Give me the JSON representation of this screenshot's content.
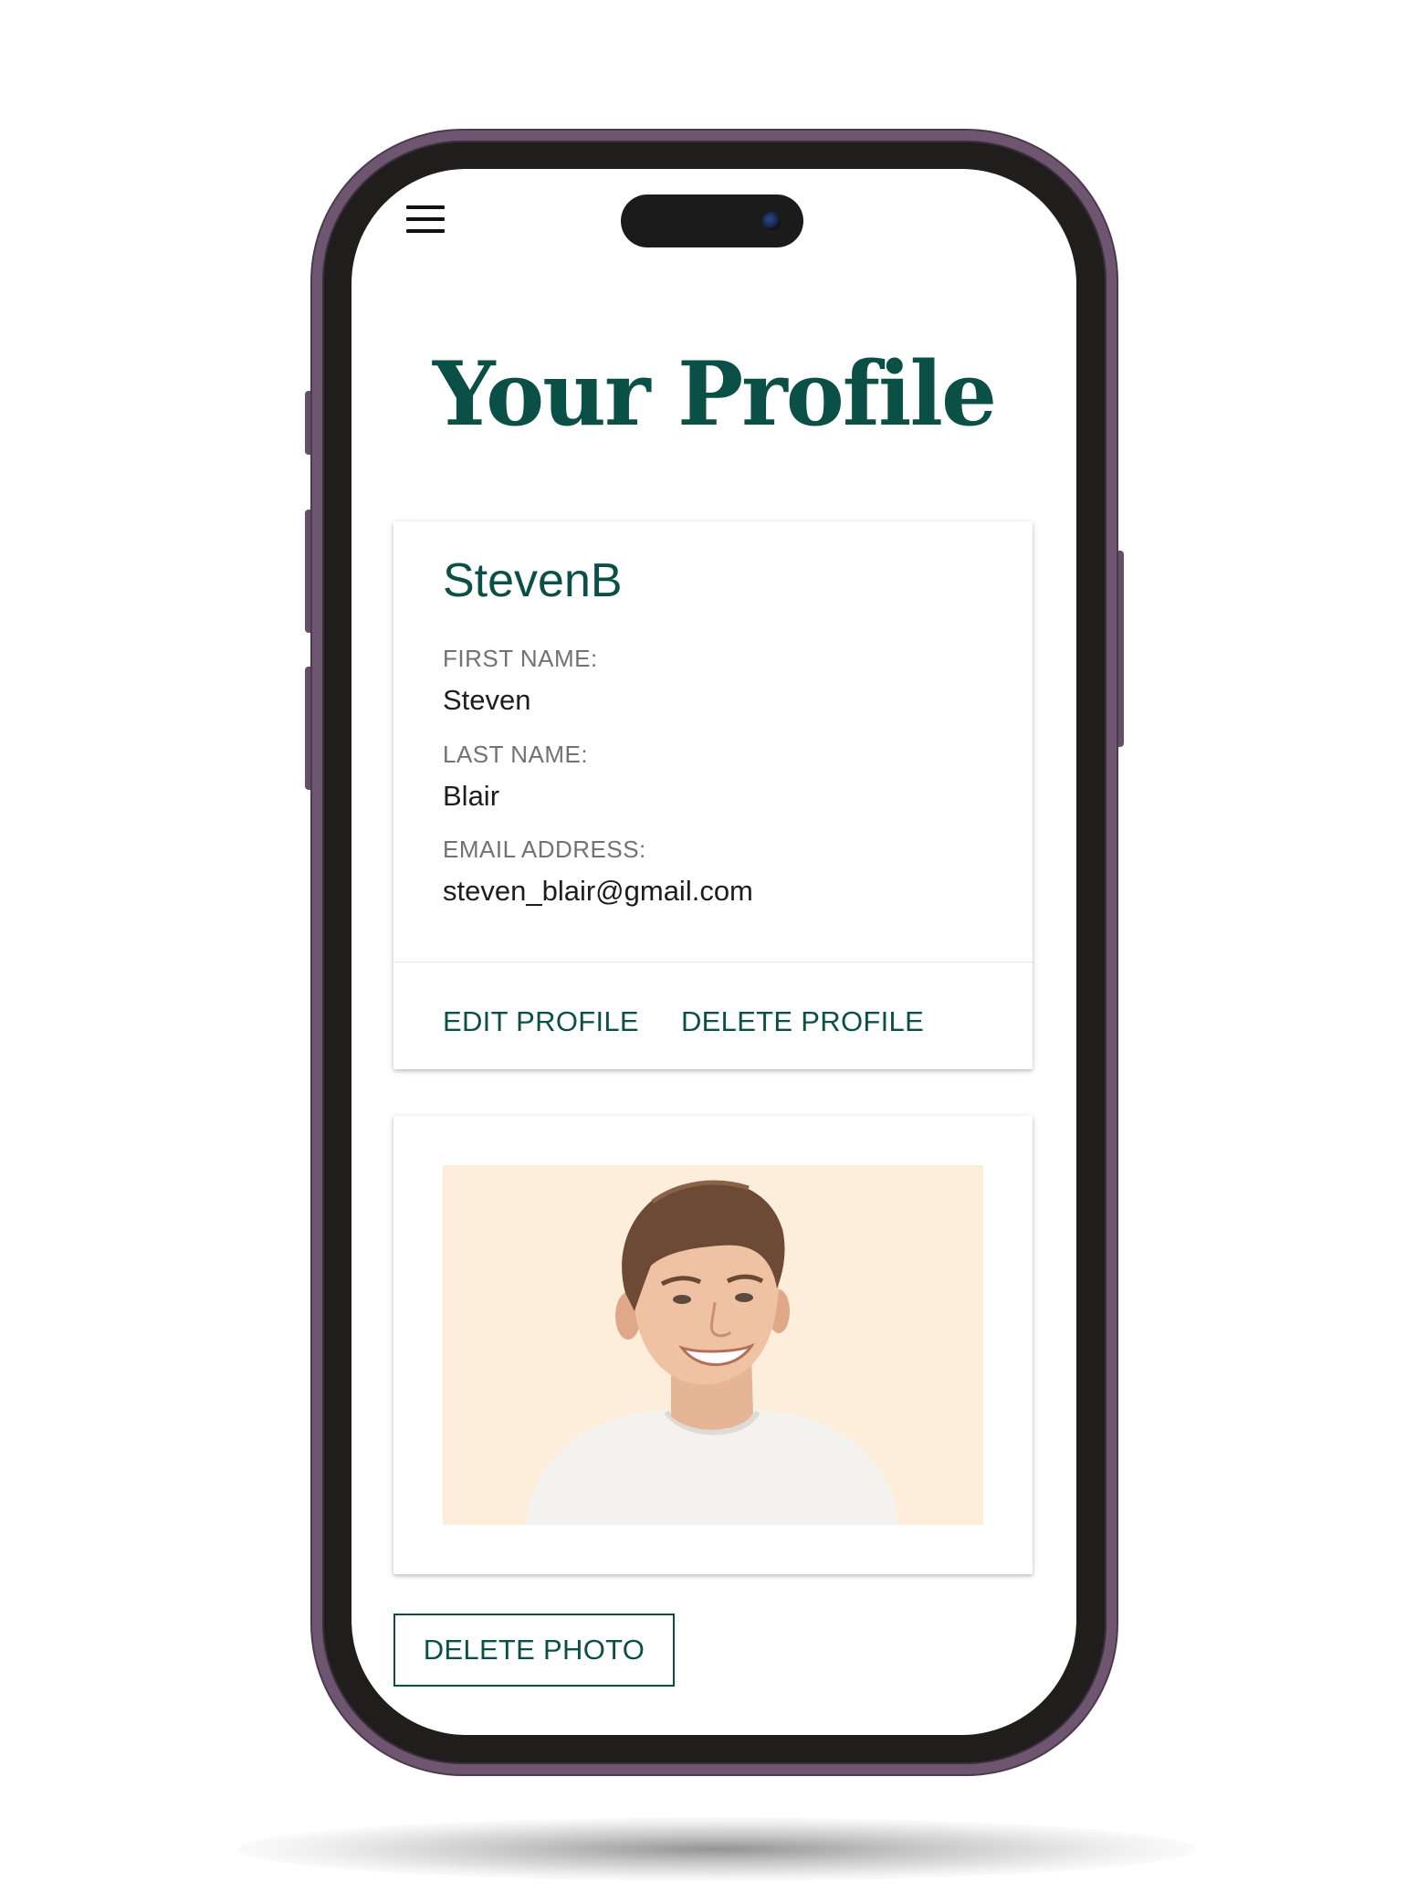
{
  "header": {
    "menu_icon": "hamburger-menu-icon"
  },
  "page": {
    "title": "Your Profile"
  },
  "profile": {
    "username": "StevenB",
    "fields": [
      {
        "label": "FIRST NAME:",
        "value": "Steven"
      },
      {
        "label": "LAST NAME:",
        "value": "Blair"
      },
      {
        "label": "EMAIL ADDRESS:",
        "value": "steven_blair@gmail.com"
      }
    ],
    "actions": {
      "edit_label": "EDIT PROFILE",
      "delete_label": "DELETE PROFILE"
    }
  },
  "photo": {
    "delete_label": "DELETE PHOTO"
  },
  "colors": {
    "accent": "#0b5046",
    "frame": "#6e5670",
    "photo_background": "#fdeedb"
  }
}
